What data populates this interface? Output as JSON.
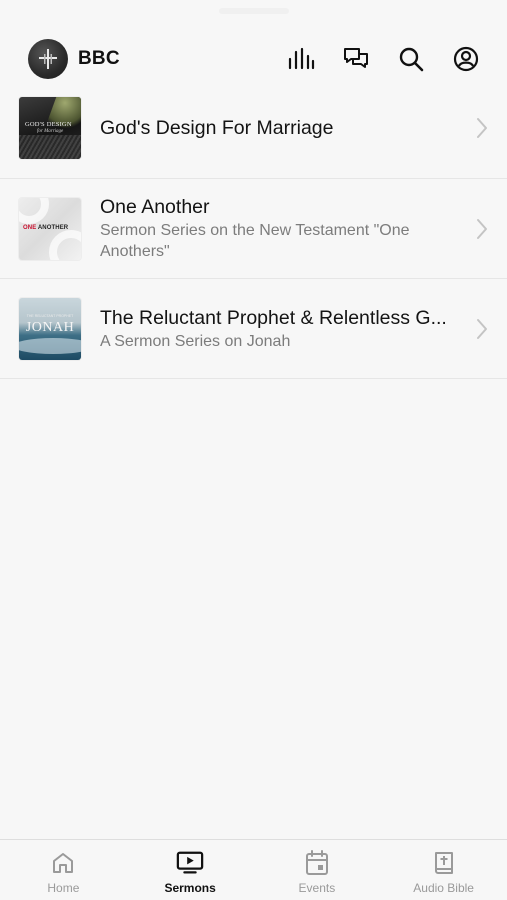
{
  "header": {
    "brand_name": "BBC",
    "icons": [
      "logo-cross-icon",
      "audio-bars-icon",
      "chat-icon",
      "search-icon",
      "profile-icon"
    ]
  },
  "sermons": [
    {
      "title": "God's Design For Marriage",
      "subtitle": "",
      "thumb_title": "GOD'S DESIGN",
      "thumb_subtitle": "for Marriage"
    },
    {
      "title": "One Another",
      "subtitle": "Sermon Series on the New Testament \"One Anothers\"",
      "thumb_title_red": "ONE",
      "thumb_title_black": "ANOTHER"
    },
    {
      "title": "The Reluctant Prophet & Relentless G...",
      "subtitle": "A Sermon Series on Jonah",
      "thumb_title": "JONAH",
      "thumb_small": "THE RELUCTANT PROPHET"
    }
  ],
  "tabs": [
    {
      "label": "Home",
      "icon": "home-icon",
      "active": false
    },
    {
      "label": "Sermons",
      "icon": "play-screen-icon",
      "active": true
    },
    {
      "label": "Events",
      "icon": "calendar-icon",
      "active": false
    },
    {
      "label": "Audio Bible",
      "icon": "bible-icon",
      "active": false
    }
  ],
  "colors": {
    "accent_red": "#c8102e",
    "background": "#f7f7f7",
    "subtitle_gray": "#7c7c7c",
    "inactive_tab": "#9a9a9a"
  }
}
